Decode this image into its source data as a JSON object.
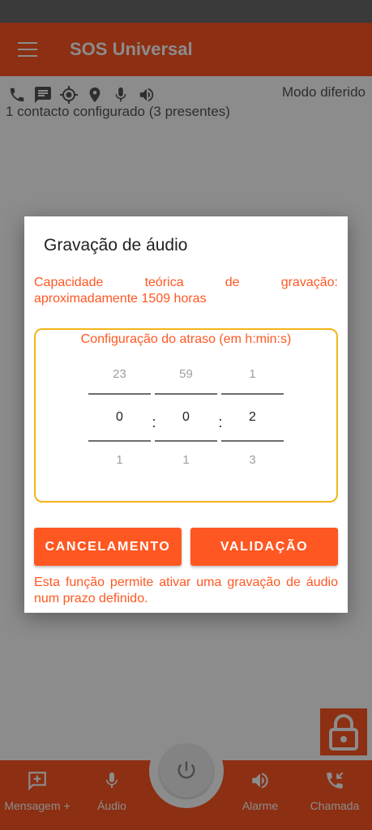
{
  "app": {
    "title": "SOS Universal",
    "mode": "Modo diferido",
    "contacts_status": "1 contacto configurado (3 presentes)",
    "status_icons": [
      "phone-icon",
      "message-icon",
      "gps-target-icon",
      "location-pin-icon",
      "microphone-icon",
      "speaker-icon"
    ]
  },
  "bottom_nav": {
    "items": [
      {
        "label": "Mensagem +",
        "icon": "add-message-icon"
      },
      {
        "label": "Áudio",
        "icon": "microphone-icon"
      },
      {
        "label": "Alarme",
        "icon": "speaker-icon"
      },
      {
        "label": "Chamada",
        "icon": "incoming-call-icon"
      }
    ],
    "center_icon": "power-icon"
  },
  "dialog": {
    "title": "Gravação de áudio",
    "capacity_line1_words": [
      "Capacidade",
      "teórica",
      "de",
      "gravação:"
    ],
    "capacity_line2": "aproximadamente 1509 horas",
    "delay_title": "Configuração do atraso (em h:min:s)",
    "picker": {
      "hours": {
        "prev": "23",
        "current": "0",
        "next": "1"
      },
      "minutes": {
        "prev": "59",
        "current": "0",
        "next": "1"
      },
      "seconds": {
        "prev": "1",
        "current": "2",
        "next": "3"
      },
      "separator": ":"
    },
    "cancel_label": "CANCELAMENTO",
    "confirm_label": "VALIDAÇÃO",
    "description": "Esta função permite ativar uma gravação de áudio num prazo definido."
  },
  "colors": {
    "accent": "#ff5722",
    "box_border": "#f4b41a",
    "scrim": "rgba(0,0,0,0.45)"
  }
}
